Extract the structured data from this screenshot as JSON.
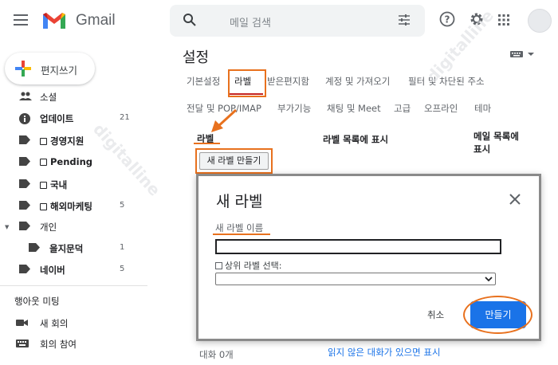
{
  "app": {
    "brand": "Gmail"
  },
  "search": {
    "placeholder": "메일 검색"
  },
  "colors": {
    "accent_orange": "#e8711e",
    "primary_blue": "#1a73e8",
    "tab_red": "#c5221f"
  },
  "compose": {
    "label": "편지쓰기"
  },
  "sidebar": {
    "items": [
      {
        "label": "소셜",
        "count": "",
        "icon": "people-icon",
        "checkbox": false
      },
      {
        "label": "업데이트",
        "count": "21",
        "icon": "info-icon",
        "checkbox": false
      },
      {
        "label": "경영지원",
        "count": "",
        "icon": "label-icon",
        "checkbox": true
      },
      {
        "label": "Pending",
        "count": "",
        "icon": "label-icon",
        "checkbox": true
      },
      {
        "label": "국내",
        "count": "",
        "icon": "label-icon",
        "checkbox": true
      },
      {
        "label": "해외마케팅",
        "count": "5",
        "icon": "label-icon",
        "checkbox": true
      },
      {
        "label": "개인",
        "count": "",
        "icon": "label-icon",
        "checkbox": false
      },
      {
        "label": "을지문덕",
        "count": "1",
        "icon": "label-icon",
        "checkbox": false
      },
      {
        "label": "네이버",
        "count": "5",
        "icon": "label-icon",
        "checkbox": false
      }
    ],
    "meet": {
      "title": "행아웃 미팅",
      "items": [
        {
          "label": "새 회의",
          "icon": "video-camera-icon"
        },
        {
          "label": "회의 참여",
          "icon": "keyboard-icon"
        }
      ]
    }
  },
  "settings": {
    "title": "설정",
    "tabs_row1": [
      "기본설정",
      "라벨",
      "받은편지함",
      "계정 및 가져오기",
      "필터 및 차단된 주소"
    ],
    "tabs_row2": [
      "전달 및 POP/IMAP",
      "부가기능",
      "채팅 및 Meet",
      "고급",
      "오프라인",
      "테마"
    ],
    "active_tab": "라벨",
    "columns": {
      "label": "라벨",
      "show_in_label_list": "라벨 목록에 표시",
      "show_in_message_list": "메일 목록에\n표시"
    },
    "new_label_button": "새 라벨 만들기",
    "footer_left": "대화 0개",
    "footer_right": "읽지 않은 대화가 있으면 표시"
  },
  "watermark": "digitalline",
  "dialog": {
    "title": "새 라벨",
    "field_label": "새 라벨 이름",
    "input_value": "",
    "nest_checkbox": "상위 라벨 선택:",
    "nest_select_value": "",
    "cancel": "취소",
    "create": "만들기"
  }
}
